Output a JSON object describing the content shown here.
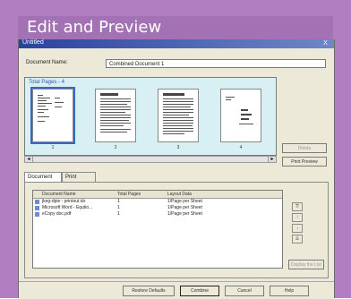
{
  "banner": {
    "title": "Edit and Preview"
  },
  "window": {
    "title": "Untitled",
    "close_label": "X"
  },
  "document_name": {
    "label": "Document Name:",
    "value": "Combined Document 1"
  },
  "thumbnails": {
    "header": "Total Pages - 4",
    "pages": [
      "1",
      "2",
      "3",
      "4"
    ]
  },
  "side_buttons": {
    "delete": "Delete",
    "print_preview": "Print Preview",
    "display_list": "Display the List"
  },
  "tabs": [
    {
      "label": "Document List"
    },
    {
      "label": "Print Settings"
    }
  ],
  "document_list": {
    "columns": [
      "Document Name",
      "Total Pages",
      "Layout Data"
    ],
    "rows": [
      [
        "jkeg-dpie - printout.do",
        "1",
        "1/Page per Sheet"
      ],
      [
        "Microsoft Word - Equtio...",
        "1",
        "1/Page per Sheet"
      ],
      [
        "eCopy doc.pdf",
        "1",
        "1/Page per Sheet"
      ]
    ]
  },
  "bottom_buttons": {
    "restore": "Restore Defaults",
    "combine": "Combine",
    "cancel": "Cancel",
    "help": "Help"
  }
}
